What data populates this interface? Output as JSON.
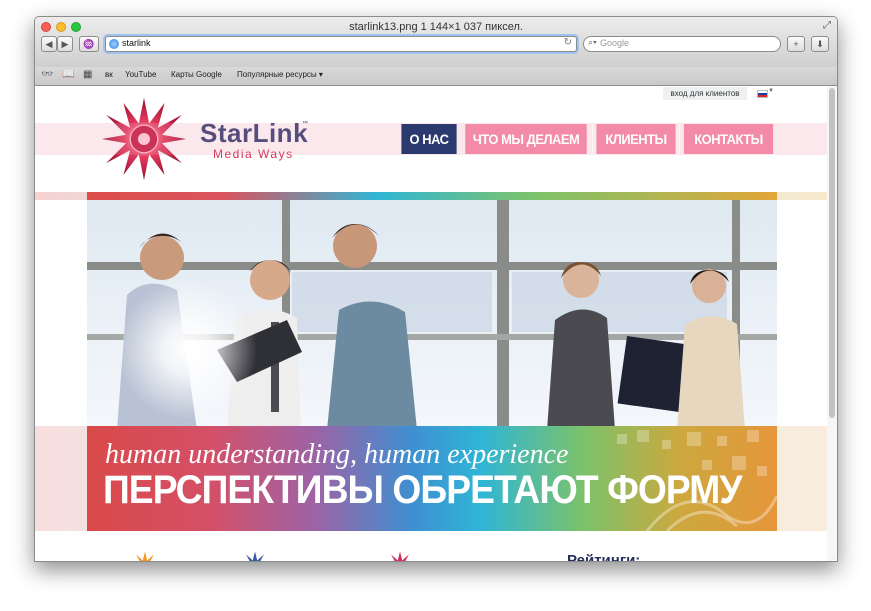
{
  "window": {
    "title": "starlink13.png 1 144×1 037 пиксел."
  },
  "toolbar": {
    "url": "starlink",
    "search_placeholder": "Google"
  },
  "bookmarks": [
    "вк",
    "YouTube",
    "Карты Google",
    "Популярные ресурсы"
  ],
  "site": {
    "client_login": "вход для клиентов",
    "logo_name": "StarLink",
    "logo_tm": "™",
    "logo_sub": "Media Ways",
    "nav": [
      "О НАС",
      "ЧТО МЫ ДЕЛАЕМ",
      "КЛИЕНТЫ",
      "КОНТАКТЫ"
    ],
    "tagline": "human understanding, human experience",
    "headline": "ПЕРСПЕКТИВЫ ОБРЕТАЮТ ФОРМУ",
    "ratings_title": "Рейтинги:"
  },
  "colors": {
    "nav_active": "#2b3a6e",
    "nav_inactive": "#f28aa8",
    "brand_red": "#d32f57"
  }
}
